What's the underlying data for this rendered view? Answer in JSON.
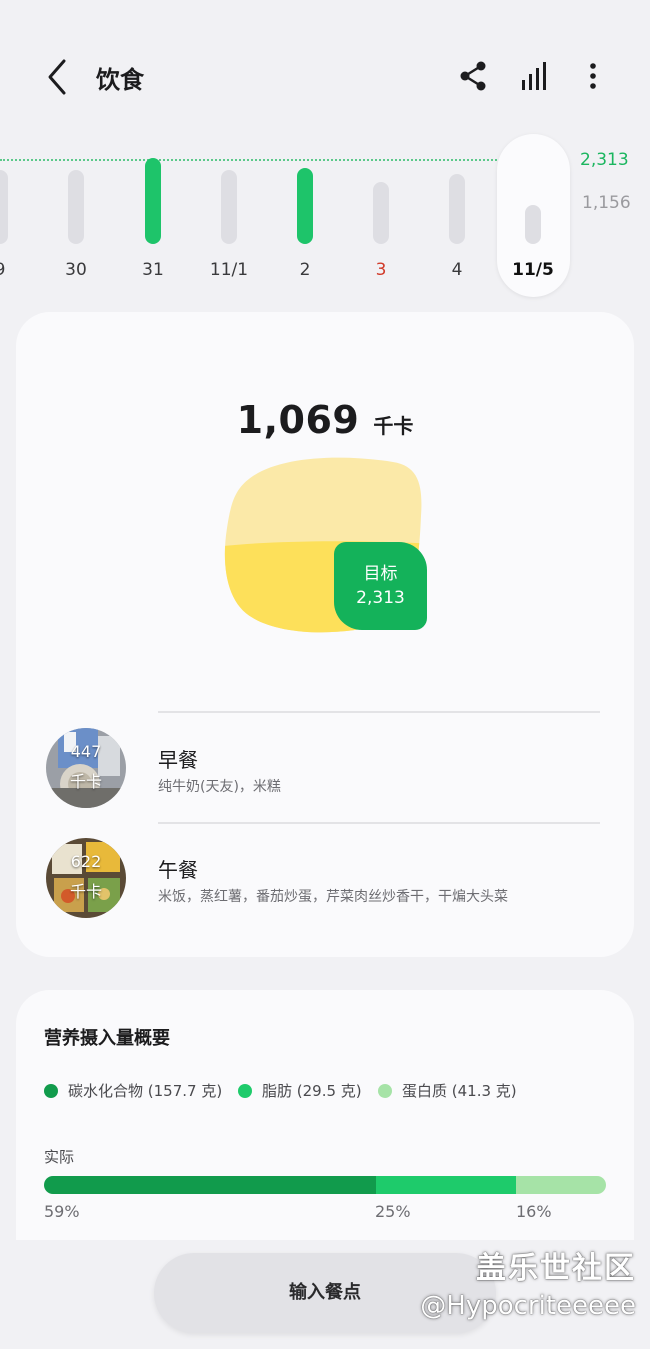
{
  "header": {
    "title": "饮食",
    "icons": [
      "back-icon",
      "share-icon",
      "stats-icon",
      "more-icon"
    ]
  },
  "timeline": {
    "goal_label": "2,313",
    "avg_label": "1,156",
    "days": [
      {
        "label": "9",
        "highlight": false
      },
      {
        "label": "30",
        "highlight": false
      },
      {
        "label": "31",
        "highlight": true
      },
      {
        "label": "11/1",
        "highlight": false
      },
      {
        "label": "2",
        "highlight": true
      },
      {
        "label": "3",
        "highlight": false,
        "holiday": true
      },
      {
        "label": "4",
        "highlight": false
      },
      {
        "label": "11/5",
        "highlight": false,
        "selected": true
      }
    ]
  },
  "summary": {
    "calories": "1,069",
    "unit": "千卡",
    "target_label": "目标",
    "target_value": "2,313"
  },
  "meals": [
    {
      "name": "早餐",
      "calories": "447",
      "unit": "千卡",
      "desc": "纯牛奶(天友)，米糕"
    },
    {
      "name": "午餐",
      "calories": "622",
      "unit": "千卡",
      "desc": "米饭，蒸红薯，番茄炒蛋，芹菜肉丝炒香干，干煸大头菜"
    }
  ],
  "nutrition": {
    "title": "营养摄入量概要",
    "legend": [
      {
        "label": "碳水化合物 (157.7 克)",
        "color": "#119b4c"
      },
      {
        "label": "脂肪 (29.5 克)",
        "color": "#1ecb6b"
      },
      {
        "label": "蛋白质 (41.3 克)",
        "color": "#a6e3a7"
      }
    ],
    "actual_label": "实际",
    "bars": [
      {
        "pct": "59%",
        "value": 59,
        "color": "#119b4c"
      },
      {
        "pct": "25%",
        "value": 25,
        "color": "#1ecb6b"
      },
      {
        "pct": "16%",
        "value": 16,
        "color": "#a6e3a7"
      }
    ]
  },
  "bottom": {
    "input_button": "输入餐点",
    "watermark_title": "盖乐世社区",
    "watermark_user": "@Hypocriteeeee"
  }
}
